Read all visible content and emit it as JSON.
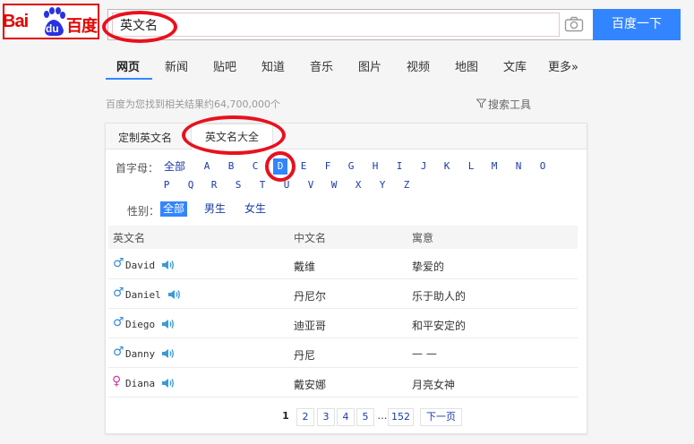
{
  "logo": {
    "text_left": "Bai",
    "text_du": "du",
    "text_right": "百度"
  },
  "search": {
    "query": "英文名",
    "button_label": "百度一下"
  },
  "nav": {
    "tabs": [
      "网页",
      "新闻",
      "贴吧",
      "知道",
      "音乐",
      "图片",
      "视频",
      "地图",
      "文库",
      "更多»"
    ]
  },
  "results": {
    "count_text": "百度为您找到相关结果约64,700,000个",
    "tools_label": "搜索工具"
  },
  "card": {
    "tabs": [
      "定制英文名",
      "英文名大全"
    ],
    "initial_label": "首字母：",
    "initials_all": "全部",
    "letters": [
      "A",
      "B",
      "C",
      "D",
      "E",
      "F",
      "G",
      "H",
      "I",
      "J",
      "K",
      "L",
      "M",
      "N",
      "O",
      "P",
      "Q",
      "R",
      "S",
      "T",
      "U",
      "V",
      "W",
      "X",
      "Y",
      "Z"
    ],
    "selected_letter": "D",
    "gender_label": "性别：",
    "genders": [
      "全部",
      "男生",
      "女生"
    ],
    "columns": [
      "英文名",
      "中文名",
      "寓意"
    ],
    "rows": [
      {
        "gender": "♂",
        "english": "David",
        "chinese": "戴维",
        "meaning": "挚爱的",
        "color": "#3a8cd8"
      },
      {
        "gender": "♂",
        "english": "Daniel",
        "chinese": "丹尼尔",
        "meaning": "乐于助人的",
        "color": "#3a8cd8"
      },
      {
        "gender": "♂",
        "english": "Diego",
        "chinese": "迪亚哥",
        "meaning": "和平安定的",
        "color": "#3a8cd8"
      },
      {
        "gender": "♂",
        "english": "Danny",
        "chinese": "丹尼",
        "meaning": "— —",
        "color": "#3a8cd8"
      },
      {
        "gender": "♀",
        "english": "Diana",
        "chinese": "戴安娜",
        "meaning": "月亮女神",
        "color": "#d63b9f"
      }
    ],
    "pagination": {
      "pages": [
        "1",
        "2",
        "3",
        "4",
        "5"
      ],
      "ellipsis": "…",
      "last": "152",
      "next": "下一页"
    }
  },
  "colors": {
    "brand_red": "#e10600",
    "accent_blue": "#3385ff",
    "link_blue": "#1a3aa8",
    "highlight_ring": "#e8111d"
  }
}
